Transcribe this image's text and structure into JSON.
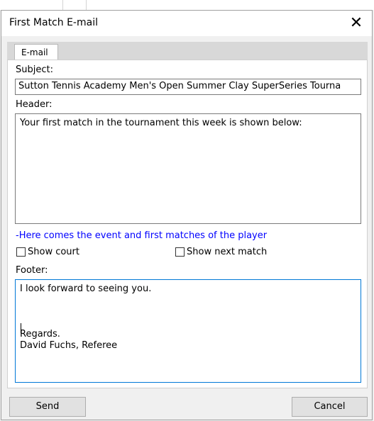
{
  "dialog": {
    "title": "First Match E-mail",
    "close_glyph": "✕"
  },
  "tabs": [
    {
      "label": "E-mail"
    }
  ],
  "subject": {
    "label": "Subject:",
    "value": "Sutton Tennis Academy Men's Open Summer Clay SuperSeries Tourna"
  },
  "header": {
    "label": "Header:",
    "value": "Your first match in the tournament this week is shown below:"
  },
  "hint": "-Here comes the event and first matches of the player",
  "options": {
    "show_court": {
      "label": "Show court",
      "checked": false
    },
    "show_next_match": {
      "label": "Show next match",
      "checked": false
    }
  },
  "footer": {
    "label": "Footer:",
    "value": "I look forward to seeing you.\n\n\n\nRegards.\nDavid Fuchs, Referee"
  },
  "buttons": {
    "send": "Send",
    "cancel": "Cancel"
  },
  "colors": {
    "hint_text": "#0000ff",
    "focus_border": "#0078d7"
  }
}
